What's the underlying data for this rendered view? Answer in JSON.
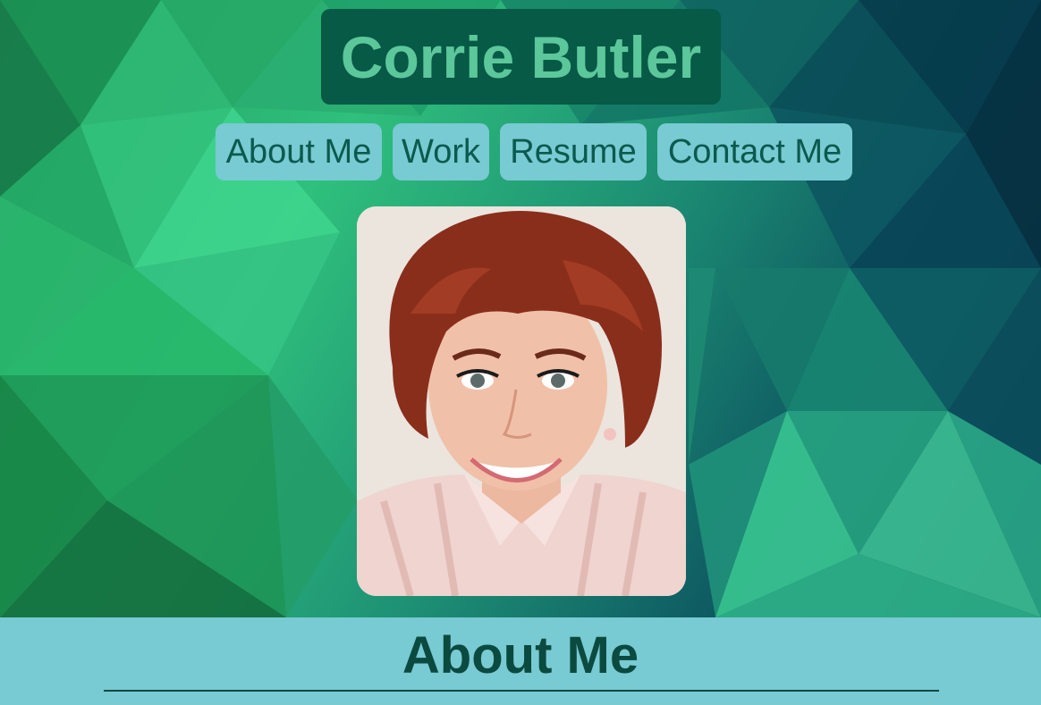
{
  "site": {
    "title": "Corrie Butler"
  },
  "nav": {
    "items": [
      {
        "label": "About Me"
      },
      {
        "label": "Work"
      },
      {
        "label": "Resume"
      },
      {
        "label": "Contact Me"
      }
    ]
  },
  "profile_photo": {
    "alt": "Portrait photo"
  },
  "about": {
    "heading": "About Me"
  },
  "colors": {
    "title_bg": "#065a46",
    "title_text": "#5cc79a",
    "nav_bg": "#78cad3",
    "nav_text": "#0b5a4d",
    "section_bg": "#78cad3",
    "heading_text": "#0b4a3f"
  }
}
